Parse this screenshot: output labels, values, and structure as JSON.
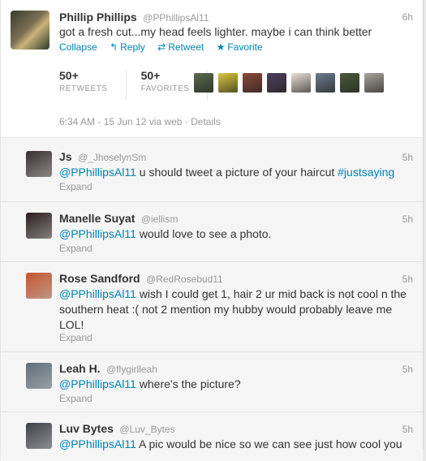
{
  "main_tweet": {
    "fullname": "Phillip Phillips",
    "screenname": "@PPhillipsAl11",
    "time": "6h",
    "text": "got a fresh cut...my head feels lighter. maybe i can think better",
    "actions": {
      "collapse": "Collapse",
      "reply": "Reply",
      "retweet": "Retweet",
      "favorite": "Favorite"
    },
    "retweets": {
      "count": "50+",
      "label": "RETWEETS"
    },
    "favorites": {
      "count": "50+",
      "label": "FAVORITES"
    },
    "datetime": "6:34 AM - 15 Jun 12 via web",
    "details_label": "Details",
    "favoriter_colors": [
      "#5a6b4c",
      "#d8c63a",
      "#8a4a3a",
      "#4e3f5c",
      "#e8e0d5",
      "#6b7a8c",
      "#4a5a3a",
      "#a8a49a"
    ]
  },
  "replies": [
    {
      "fullname": "Js",
      "screenname": "@_JhoselynSm",
      "time": "5h",
      "mention": "@PPhillipsAl11",
      "text_lines": [
        " u should tweet a picture of your haircut "
      ],
      "hashtag": "#justsaying",
      "expand": "Expand",
      "avatar_color": "#3a3030"
    },
    {
      "fullname": "Manelle Suyat",
      "screenname": "@iellism",
      "time": "5h",
      "mention": "@PPhillipsAl11",
      "text_lines": [
        " would love to see a photo."
      ],
      "expand": "Expand",
      "avatar_color": "#2a1d1d"
    },
    {
      "fullname": "Rose Sandford",
      "screenname": "@RedRosebud11",
      "time": "5h",
      "mention": "@PPhillipsAl11",
      "text_lines": [
        " wish I could get 1, hair 2 ur mid back is not cool n the",
        "southern heat :( not 2 mention my hubby would probably leave me",
        "LOL!"
      ],
      "expand": "Expand",
      "avatar_color": "#c4562e"
    },
    {
      "fullname": "Leah H.",
      "screenname": "@flygirlleah",
      "time": "5h",
      "mention": "@PPhillipsAl11",
      "text_lines": [
        " where's the picture?"
      ],
      "expand": "Expand",
      "avatar_color": "#5f6f7a"
    },
    {
      "fullname": "Luv Bytes",
      "screenname": "@Luv_Bytes",
      "time": "5h",
      "mention": "@PPhillipsAl11",
      "text_lines": [
        " A pic would be nice so we can see just how cool you"
      ],
      "expand": "",
      "avatar_color": "#3d4148"
    }
  ]
}
